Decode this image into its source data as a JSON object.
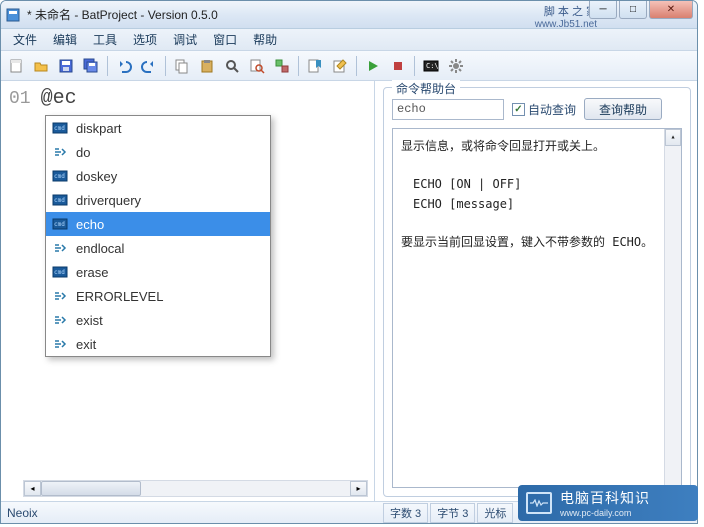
{
  "window": {
    "title": "* 未命名 - BatProject - Version 0.5.0",
    "right_caption": "脚 本 之 家",
    "right_url": "www.Jb51.net"
  },
  "menu": {
    "items": [
      "文件",
      "编辑",
      "工具",
      "选项",
      "调试",
      "窗口",
      "帮助"
    ]
  },
  "toolbar": {
    "icons": [
      "new-file-icon",
      "open-icon",
      "save-icon",
      "save-all-icon",
      "sep",
      "undo-icon",
      "redo-icon",
      "sep",
      "copy-icon",
      "paste-icon",
      "find-icon",
      "find-in-files-icon",
      "replace-icon",
      "sep",
      "bookmark-icon",
      "edit-icon",
      "sep",
      "run-icon",
      "stop-icon",
      "sep",
      "cmd-icon",
      "gear-icon"
    ]
  },
  "editor": {
    "line_number": "01",
    "text": "@ec"
  },
  "autocomplete": {
    "items": [
      {
        "icon": "cmd",
        "label": "diskpart"
      },
      {
        "icon": "flow",
        "label": "do"
      },
      {
        "icon": "cmd",
        "label": "doskey"
      },
      {
        "icon": "cmd",
        "label": "driverquery"
      },
      {
        "icon": "cmd",
        "label": "echo",
        "selected": true
      },
      {
        "icon": "flow",
        "label": "endlocal"
      },
      {
        "icon": "cmd",
        "label": "erase"
      },
      {
        "icon": "flow",
        "label": "ERRORLEVEL"
      },
      {
        "icon": "flow",
        "label": "exist"
      },
      {
        "icon": "flow",
        "label": "exit"
      }
    ]
  },
  "help": {
    "group_title": "命令帮助台",
    "input_value": "echo",
    "auto_query_label": "自动查询",
    "auto_query_checked": true,
    "query_button": "查询帮助",
    "output_lines": [
      "显示信息，或将命令回显打开或关上。",
      "",
      "  ECHO [ON | OFF]",
      "  ECHO [message]",
      "",
      "要显示当前回显设置，键入不带参数的 ECHO。"
    ]
  },
  "status": {
    "left": "Neoix",
    "cells": [
      "字数 3",
      "字节 3",
      "光标"
    ]
  },
  "watermark": {
    "text": "电脑百科知识",
    "sub": "www.pc-daily.com"
  }
}
